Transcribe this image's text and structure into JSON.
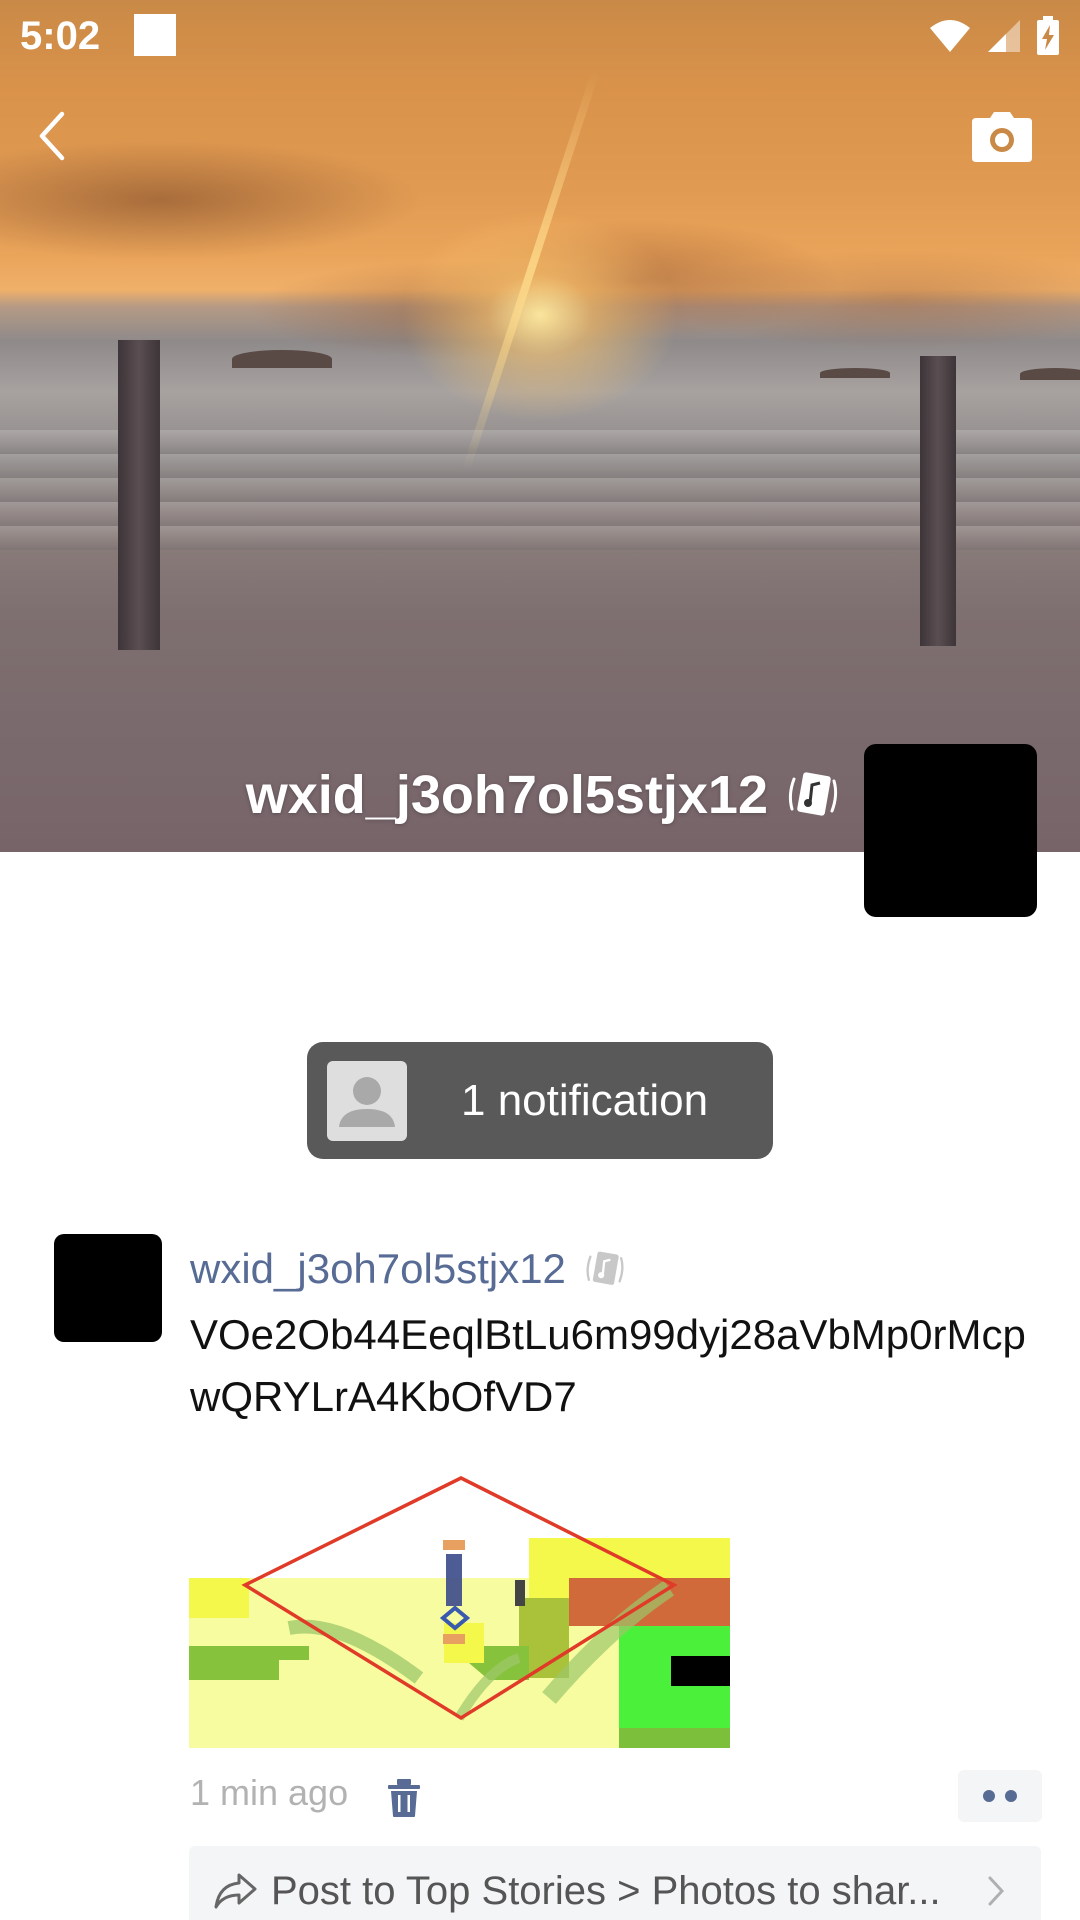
{
  "status_bar": {
    "time": "5:02",
    "icons": [
      "wifi-icon",
      "cellular-signal-icon",
      "battery-charging-icon"
    ]
  },
  "header": {
    "back_icon": "back-chevron-icon",
    "camera_icon": "camera-icon",
    "profile_name": "wxid_j3oh7ol5stjx12",
    "name_badge_icon": "music-card-icon"
  },
  "notification": {
    "text": "1 notification",
    "avatar_icon": "default-person-icon"
  },
  "post": {
    "author": "wxid_j3oh7ol5stjx12",
    "author_badge_icon": "music-card-icon",
    "text": "VOe2Ob44EeqlBtLu6m99dyj28aVbMp0rMcpwQRYLrA4KbOfVD7",
    "time": "1 min ago",
    "delete_icon": "trash-icon",
    "more_icon": "more-dots-icon",
    "share": {
      "icon": "share-arrow-icon",
      "text": "Post to Top Stories > Photos to shar...",
      "chevron_icon": "chevron-right-icon"
    }
  },
  "colors": {
    "link_blue": "#576b95",
    "notification_bg": "#595959",
    "time_gray": "#b2b2b2",
    "share_bg": "#f4f5f7"
  }
}
